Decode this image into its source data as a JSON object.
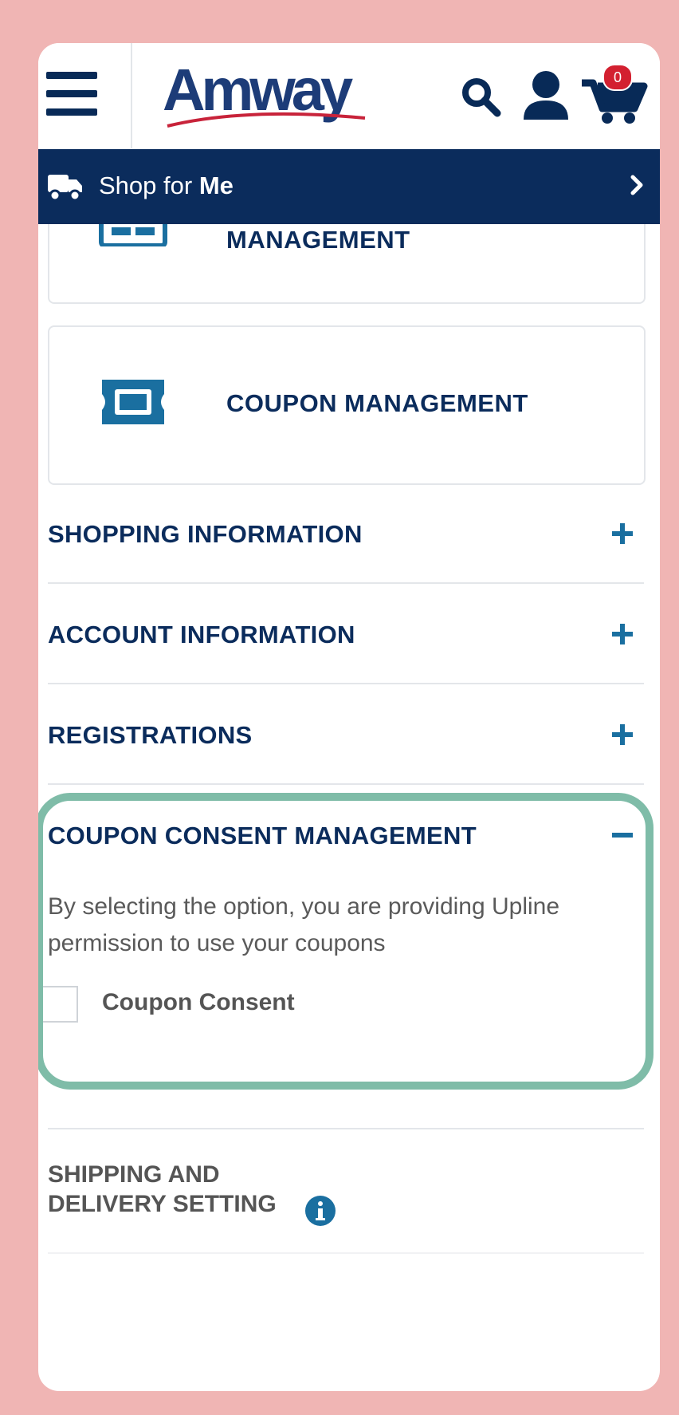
{
  "header": {
    "logo_text": "Amway",
    "cart_count": "0"
  },
  "shop_bar": {
    "prefix": "Shop for ",
    "emphasis": "Me"
  },
  "cards": {
    "first_partial_title": "MANAGEMENT",
    "coupon_title": "COUPON MANAGEMENT"
  },
  "accordion": {
    "shopping": "SHOPPING INFORMATION",
    "account": "ACCOUNT INFORMATION",
    "registrations": "REGISTRATIONS",
    "coupon_consent": "COUPON CONSENT MANAGEMENT"
  },
  "coupon_consent": {
    "description": "By selecting the option, you are providing Upline permission to use your coupons",
    "checkbox_label": "Coupon Consent",
    "checked": false
  },
  "shipping": {
    "label_line1": "SHIPPING AND",
    "label_line2": "DELIVERY SETTING"
  },
  "colors": {
    "navy": "#0b2c5c",
    "accent_blue": "#1a6fa0",
    "frame_pink": "#f0b5b4",
    "highlight_green": "#7fbca8",
    "badge_red": "#d32030"
  }
}
